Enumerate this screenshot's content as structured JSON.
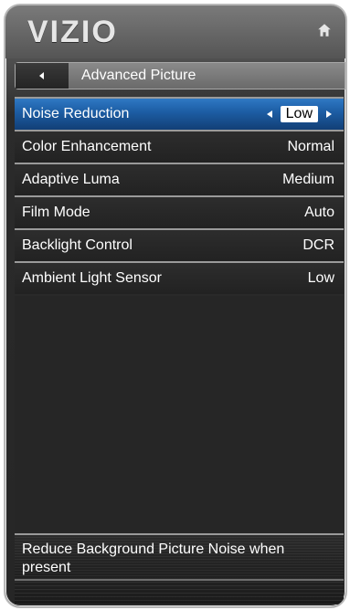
{
  "brand": {
    "logo_text": "VIZIO"
  },
  "header": {
    "home_icon": "home-icon"
  },
  "nav": {
    "back_icon": "chevron-left-icon",
    "title": "Advanced Picture"
  },
  "menu": {
    "items": [
      {
        "label": "Noise Reduction",
        "value": "Low"
      },
      {
        "label": "Color Enhancement",
        "value": "Normal"
      },
      {
        "label": "Adaptive Luma",
        "value": "Medium"
      },
      {
        "label": "Film Mode",
        "value": "Auto"
      },
      {
        "label": "Backlight Control",
        "value": "DCR"
      },
      {
        "label": "Ambient Light Sensor",
        "value": "Low"
      }
    ],
    "selected_index": 0
  },
  "help": {
    "text": "Reduce Background Picture Noise when present"
  },
  "colors": {
    "selected_row": "#1d5ea5",
    "row_bg": "#262626"
  }
}
